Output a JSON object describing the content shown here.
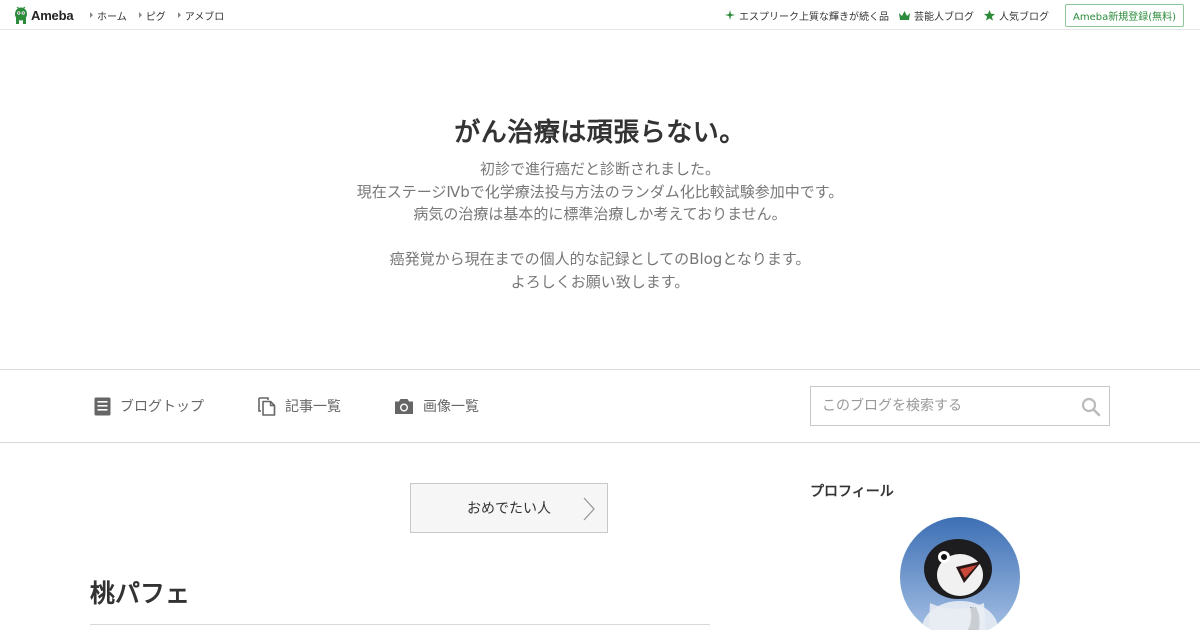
{
  "header": {
    "logo_text": "Ameba",
    "nav": [
      {
        "label": "ホーム"
      },
      {
        "label": "ピグ"
      },
      {
        "label": "アメブロ"
      }
    ],
    "links": [
      {
        "label": "エスプリーク上質な輝きが続く品",
        "icon": "sparkle-icon"
      },
      {
        "label": "芸能人ブログ",
        "icon": "crown-icon"
      },
      {
        "label": "人気ブログ",
        "icon": "star-icon"
      }
    ],
    "register_label": "Ameba新規登録(無料)"
  },
  "blog": {
    "title": "がん治療は頑張らない。",
    "description": [
      "初診で進行癌だと診断されました。",
      "現在ステージⅣbで化学療法投与方法のランダム化比較試験参加中です。",
      "病気の治療は基本的に標準治療しか考えておりません。",
      "",
      "癌発覚から現在までの個人的な記録としてのBlogとなります。",
      "よろしくお願い致します。"
    ]
  },
  "navbar": {
    "items": [
      {
        "label": "ブログトップ",
        "icon": "document-icon"
      },
      {
        "label": "記事一覧",
        "icon": "copy-icon"
      },
      {
        "label": "画像一覧",
        "icon": "camera-icon"
      }
    ],
    "search_placeholder": "このブログを検索する"
  },
  "main": {
    "hashtag_button": "おめでたい人",
    "entry_title": "桃パフェ"
  },
  "sidebar": {
    "profile_heading": "プロフィール"
  },
  "colors": {
    "brand_green": "#2d8c3c",
    "text": "#333333",
    "muted": "#777777",
    "border": "#d9d9d9"
  }
}
